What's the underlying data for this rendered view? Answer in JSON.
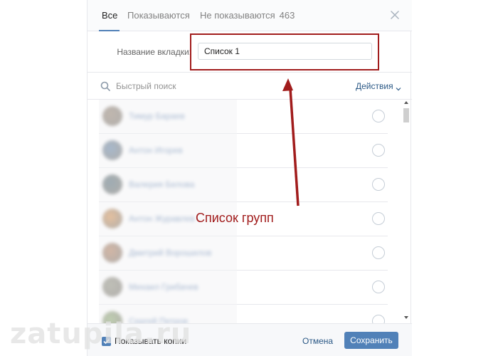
{
  "tabs": [
    {
      "label": "Все",
      "active": true
    },
    {
      "label": "Показываются",
      "active": false
    },
    {
      "label": "Не показываются",
      "count": "463",
      "active": false
    }
  ],
  "form": {
    "name_label": "Название вкладки:",
    "name_value": "Список 1"
  },
  "search": {
    "placeholder": "Быстрый поиск",
    "actions_label": "Действия"
  },
  "friends": [
    {
      "name": "Тимур Бараев",
      "avatar_color": "#8c7a68"
    },
    {
      "name": "Антон Игорев",
      "avatar_color": "#5a7ca0"
    },
    {
      "name": "Валерия Белова",
      "avatar_color": "#4a6470"
    },
    {
      "name": "Антон Журавлев",
      "avatar_color": "#d48c48"
    },
    {
      "name": "Дмитрий Ворошилов",
      "avatar_color": "#b07855"
    },
    {
      "name": "Михаил Грибачев",
      "avatar_color": "#8a8a78"
    },
    {
      "name": "Сергей Петров",
      "avatar_color": "#8aa86c"
    }
  ],
  "annotation": "Список групп",
  "footer": {
    "show_copies_label": "Показывать копии",
    "show_copies_checked": true,
    "cancel_label": "Отмена",
    "save_label": "Сохранить"
  },
  "watermark": "zatupila.ru",
  "colors": {
    "accent": "#5181b8",
    "link": "#2a5885",
    "annotation": "#a11c1c"
  }
}
